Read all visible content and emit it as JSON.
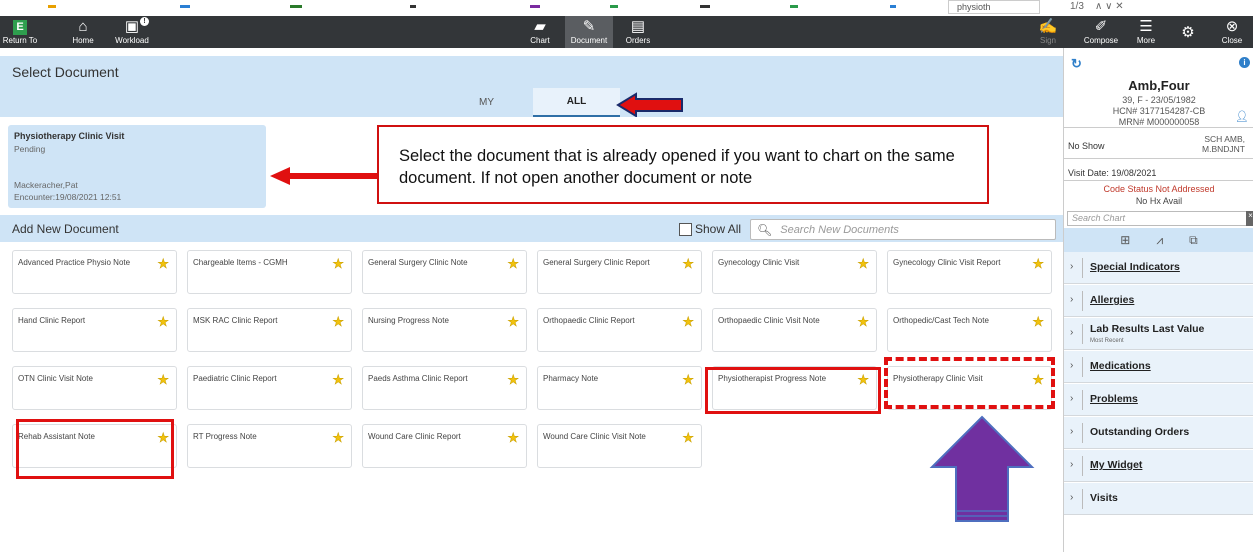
{
  "top_fragment": {
    "search_text": "physioth",
    "counter": "1/3",
    "controls": "∧  ∨  ✕"
  },
  "toolbar": {
    "return_label": "Return To",
    "return_icon": "E",
    "home_label": "Home",
    "workload_label": "Workload",
    "workload_badge": "!",
    "chart_label": "Chart",
    "document_label": "Document",
    "orders_label": "Orders",
    "sign_label": "Sign",
    "compose_label": "Compose",
    "more_label": "More",
    "close_label": "Close"
  },
  "main": {
    "header": "Select Document",
    "tabs": {
      "my": "MY",
      "all": "ALL"
    },
    "opened_doc": {
      "title": "Physiotherapy Clinic Visit",
      "status": "Pending",
      "author": "Mackeracher,Pat",
      "encounter": "Encounter:19/08/2021 12:51"
    },
    "callout": "Select the document that is already opened if you want to chart on the same document. If not open another document or note",
    "add_header": "Add New Document",
    "show_all": "Show All",
    "search_placeholder": "Search New Documents",
    "documents": [
      "Advanced Practice Physio Note",
      "Chargeable Items - CGMH",
      "General Surgery Clinic Note",
      "General Surgery Clinic Report",
      "Gynecology Clinic Visit",
      "Gynecology Clinic Visit Report",
      "Hand Clinic Report",
      "MSK RAC Clinic Report",
      "Nursing Progress Note",
      "Orthopaedic Clinic Report",
      "Orthopaedic Clinic Visit Note",
      "Orthopedic/Cast Tech Note",
      "OTN Clinic Visit Note",
      "Paediatric Clinic Report",
      "Paeds Asthma Clinic Report",
      "Pharmacy Note",
      "Physiotherapist Progress Note",
      "Physiotherapy Clinic Visit",
      "Rehab Assistant Note",
      "RT Progress Note",
      "Wound Care Clinic Report",
      "Wound Care Clinic Visit Note"
    ]
  },
  "patient": {
    "name": "Amb,Four",
    "age_sex_dob": "39, F - 23/05/1982",
    "hcn": "HCN# 3177154287-CB",
    "mrn": "MRN# M000000058",
    "no_show": "No Show",
    "sch_line1": "SCH AMB,",
    "sch_line2": "M.BNDJNT",
    "visit_date": "Visit Date: 19/08/2021",
    "code_status": "Code Status Not Addressed",
    "hx": "No Hx Avail",
    "search_chart": "Search Chart"
  },
  "right_sections": [
    {
      "label": "Special Indicators",
      "sub": ""
    },
    {
      "label": "Allergies",
      "sub": ""
    },
    {
      "label": "Lab Results Last Value",
      "sub": "Most Recent"
    },
    {
      "label": "Medications",
      "sub": ""
    },
    {
      "label": "Problems",
      "sub": ""
    },
    {
      "label": "Outstanding Orders",
      "sub": ""
    },
    {
      "label": "My Widget",
      "sub": ""
    },
    {
      "label": "Visits",
      "sub": ""
    }
  ],
  "colors": {
    "toolbar": "#333639",
    "panel_blue": "#cfe4f6",
    "annotation_red": "#e01010",
    "arrow_purple": "#7030a0",
    "star": "#f2c20d"
  }
}
